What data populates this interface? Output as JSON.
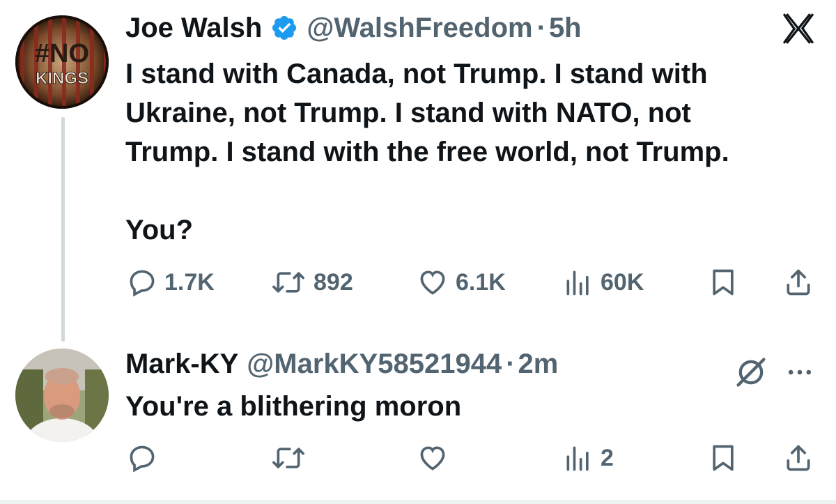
{
  "main_tweet": {
    "author_name": "Joe Walsh",
    "handle": "@WalshFreedom",
    "separator": "·",
    "time": "5h",
    "avatar_text_top": "#NO",
    "avatar_text_bottom": "KINGS",
    "text_lines": [
      "I stand with Canada, not Trump. I stand with",
      "Ukraine, not Trump. I stand with NATO, not",
      "Trump. I stand with the free world, not Trump."
    ],
    "text_tail": "You?",
    "stats": {
      "replies": "1.7K",
      "reposts": "892",
      "likes": "6.1K",
      "views": "60K"
    }
  },
  "reply_tweet": {
    "author_name": "Mark-KY",
    "handle": "@MarkKY58521944",
    "separator": "·",
    "time": "2m",
    "text": "You're a blithering moron",
    "stats": {
      "views": "2"
    }
  },
  "colors": {
    "text": "#0f1419",
    "muted": "#536471",
    "verified_blue": "#1d9bf0",
    "thread_line": "#cfd9de"
  },
  "icons": [
    "x-logo-icon",
    "verified-icon",
    "reply-icon",
    "repost-icon",
    "like-icon",
    "views-icon",
    "bookmark-icon",
    "share-icon",
    "grok-icon",
    "more-icon"
  ]
}
